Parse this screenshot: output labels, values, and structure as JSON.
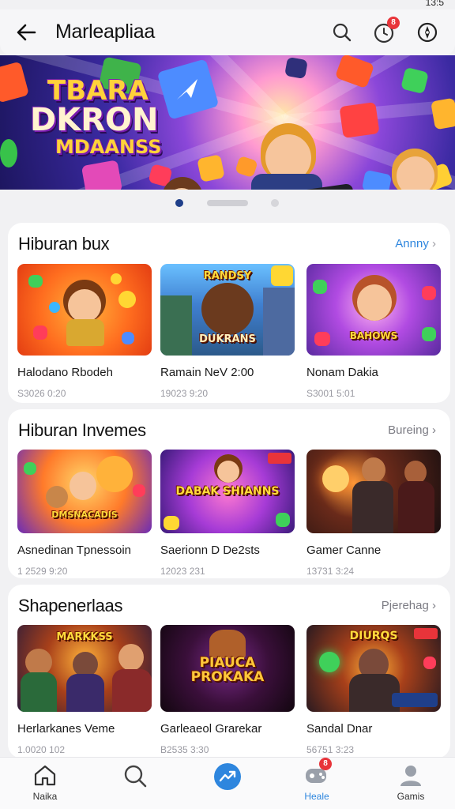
{
  "status_bar": {
    "time": "13:5"
  },
  "header": {
    "title": "Marleapliaa",
    "notification_count": "8"
  },
  "banner": {
    "title_lines": [
      "TBARA",
      "DKRON",
      "MDAANSS"
    ],
    "page_dots": 3,
    "active_dot": 0
  },
  "sections": [
    {
      "title": "Hiburan bux",
      "link": "Annny",
      "items": [
        {
          "title": "Halodano Rbodeh",
          "meta": "S3026 0:20",
          "art_text": ""
        },
        {
          "title": "Ramain NeV 2:00",
          "meta": "19023 9:20",
          "art_text": "DUKRANS"
        },
        {
          "title": "Nonam Dakia",
          "meta": "S3001 5:01",
          "art_text": "BAHOWS"
        }
      ]
    },
    {
      "title": "Hiburan Invemes",
      "link": "Bureing",
      "items": [
        {
          "title": "Asnedinan Tpnessoin",
          "meta": "1 2529 9:20",
          "art_text": "DMSNACADIS"
        },
        {
          "title": "Saerionn D De2sts",
          "meta": "12023 231",
          "art_text": "DABAK SHIANNS"
        },
        {
          "title": "Gamer Canne",
          "meta": "13731 3:24",
          "art_text": ""
        }
      ]
    },
    {
      "title": "Shapenerlaas",
      "link": "Pjerehag",
      "items": [
        {
          "title": "Herlarkanes Veme",
          "meta": "1.0020 102",
          "art_text": "MARKKSS"
        },
        {
          "title": "Garleaeol Grarekar",
          "meta": "B2535 3:30",
          "art_text": "PIAUCA PROKAKA"
        },
        {
          "title": "Sandal Dnar",
          "meta": "56751 3:23",
          "art_text": "DIURQS"
        }
      ]
    }
  ],
  "bottom_nav": {
    "items": [
      {
        "label": "Naika",
        "icon": "home-icon"
      },
      {
        "label": "",
        "icon": "search-icon"
      },
      {
        "label": "",
        "icon": "trending-icon"
      },
      {
        "label": "Heale",
        "icon": "controller-icon",
        "badge": "8"
      },
      {
        "label": "Gamis",
        "icon": "profile-icon"
      }
    ],
    "active_index": 3
  },
  "colors": {
    "accent": "#2e86de",
    "badge": "#e8343a",
    "link_blue": "#2e86de"
  }
}
